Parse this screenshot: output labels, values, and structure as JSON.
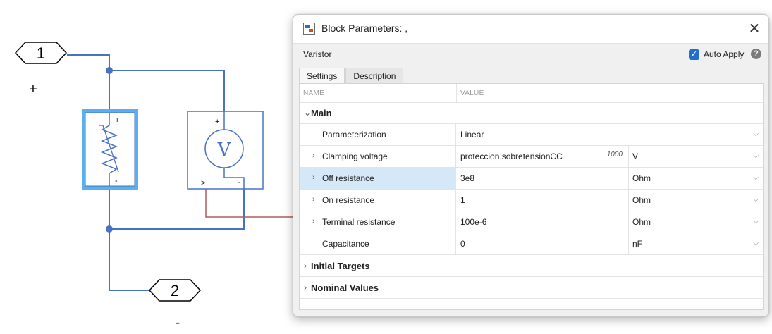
{
  "diagram": {
    "port_in": {
      "number": "1",
      "sign": "+"
    },
    "port_out": {
      "number": "2",
      "sign": "-"
    },
    "varistor": {
      "plus_mark": "+",
      "minus_mark": "-"
    },
    "voltage_sensor": {
      "glyph": "V",
      "plus_mark": "+",
      "output_mark": ">",
      "minus_mark": "-"
    },
    "colors": {
      "wire": "#4a72c4",
      "signal": "#b05c5c",
      "block_highlight": "#5ab0ee"
    }
  },
  "dialog": {
    "title": "Block Parameters: ,",
    "close_label": "✕",
    "block_name": "Varistor",
    "auto_apply": {
      "label": "Auto Apply",
      "checked": true,
      "check_glyph": "✓"
    },
    "help_label": "?",
    "tabs": [
      {
        "label": "Settings",
        "active": true
      },
      {
        "label": "Description",
        "active": false
      }
    ],
    "table": {
      "col_name": "NAME",
      "col_value": "VALUE",
      "groups": [
        {
          "label": "Main",
          "expanded": true,
          "chevron": "⌄",
          "rows": [
            {
              "name": "Parameterization",
              "value": "Linear",
              "unit": "",
              "expander": ""
            },
            {
              "name": "Clamping voltage",
              "value": "proteccion.sobretensionCC",
              "meta": "1000",
              "unit": "V",
              "expander": "›"
            },
            {
              "name": "Off resistance",
              "value": "3e8",
              "unit": "Ohm",
              "expander": "›",
              "selected": true
            },
            {
              "name": "On resistance",
              "value": "1",
              "unit": "Ohm",
              "expander": "›"
            },
            {
              "name": "Terminal resistance",
              "value": "100e-6",
              "unit": "Ohm",
              "expander": "›"
            },
            {
              "name": "Capacitance",
              "value": "0",
              "unit": "nF",
              "expander": ""
            }
          ]
        },
        {
          "label": "Initial Targets",
          "expanded": false,
          "chevron": "›"
        },
        {
          "label": "Nominal Values",
          "expanded": false,
          "chevron": "›"
        }
      ]
    },
    "dropdown_glyph": "⌵",
    "colors": {
      "accent": "#1e6fd0",
      "selected_row": "#d5e8f7"
    }
  }
}
